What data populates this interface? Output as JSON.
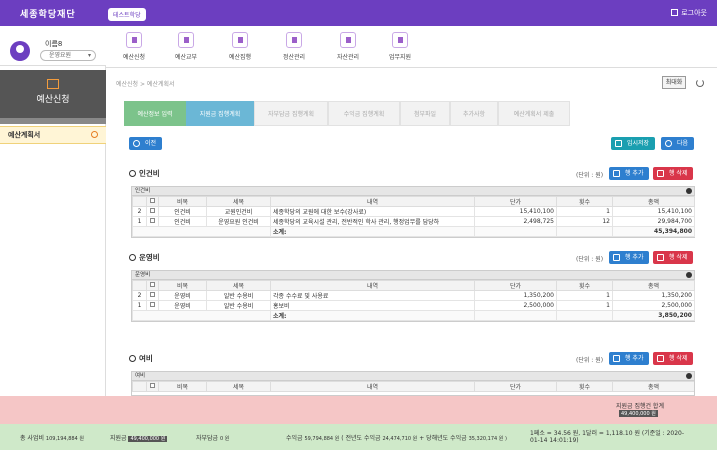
{
  "header": {
    "logo": "세종학당재단",
    "env_badge": "테스트학당",
    "logout": "로그아웃"
  },
  "profile": {
    "name": "이름8",
    "role": "운영요원"
  },
  "nav": [
    {
      "label": "예산신청"
    },
    {
      "label": "예산교부"
    },
    {
      "label": "예산집행"
    },
    {
      "label": "정산관리"
    },
    {
      "label": "자산관리"
    },
    {
      "label": "업무지원"
    }
  ],
  "sidebar": {
    "title": "예산신청",
    "item": "예산계획서"
  },
  "breadcrumb": "예산신청 > 예산계획서",
  "toolbar": {
    "maximize": "최대화",
    "prev": "이전",
    "save_temp": "임시저장",
    "next": "다음"
  },
  "steps": [
    {
      "label": "예산정보 입력"
    },
    {
      "label": "지원금 집행계획"
    },
    {
      "label": "자부담금 집행계획"
    },
    {
      "label": "수익금 집행계획"
    },
    {
      "label": "첨부파일"
    },
    {
      "label": "추가사항"
    },
    {
      "label": "예산계획서 제출"
    }
  ],
  "common": {
    "unit": "(단위 : 원)",
    "add_row": "행 추가",
    "del_row": "행 삭제",
    "subtotal": "소계:"
  },
  "columns": [
    "비목",
    "세목",
    "내역",
    "단가",
    "횟수",
    "총액"
  ],
  "sections": {
    "labor": {
      "title": "인건비",
      "caption": "인건비",
      "rows": [
        {
          "no": "2",
          "cat": "인건비",
          "sub": "교원인건비",
          "desc": "세종학당의 교원에 대한 보수(강사료)",
          "price": "15,410,100",
          "count": "1",
          "total": "15,410,100"
        },
        {
          "no": "1",
          "cat": "인건비",
          "sub": "운영요원 인건비",
          "desc": "세종학당의 교육시설 관리, 전반적인 학사 관리, 행정업무를 담당하",
          "price": "2,498,725",
          "count": "12",
          "total": "29,984,700"
        }
      ],
      "subtotal": "45,394,800"
    },
    "ops": {
      "title": "운영비",
      "caption": "운영비",
      "rows": [
        {
          "no": "2",
          "cat": "운영비",
          "sub": "일반 수용비",
          "desc": "각종 수수료 및 사용료",
          "price": "1,350,200",
          "count": "1",
          "total": "1,350,200"
        },
        {
          "no": "1",
          "cat": "운영비",
          "sub": "일반 수용비",
          "desc": "홍보비",
          "price": "2,500,000",
          "count": "1",
          "total": "2,500,000"
        }
      ],
      "subtotal": "3,850,200"
    },
    "reserve": {
      "title": "여비",
      "caption": "여비"
    }
  },
  "pink": {
    "label": "지원금 집행건 합계",
    "value": "49,400,000 원"
  },
  "footer": {
    "total_label": "총 사업비",
    "total_value": "109,194,884 원",
    "support_label": "지원금",
    "support_value": "49,400,000 원",
    "self_label": "자부담금",
    "self_value": "0 원",
    "income_label": "수익금",
    "income_value": "59,794,884 원",
    "income_detail_a": "( 전년도 수익금",
    "income_detail_b": "24,474,710 원",
    "income_detail_c": "+ 당해년도 수익금",
    "income_detail_d": "35,320,174 원 )",
    "rate_line1": "1페소 = 34.56 원, 1달러 = 1,118.10 원 (기준일 : 2020-",
    "rate_line2": "01-14 14:01:19)"
  }
}
